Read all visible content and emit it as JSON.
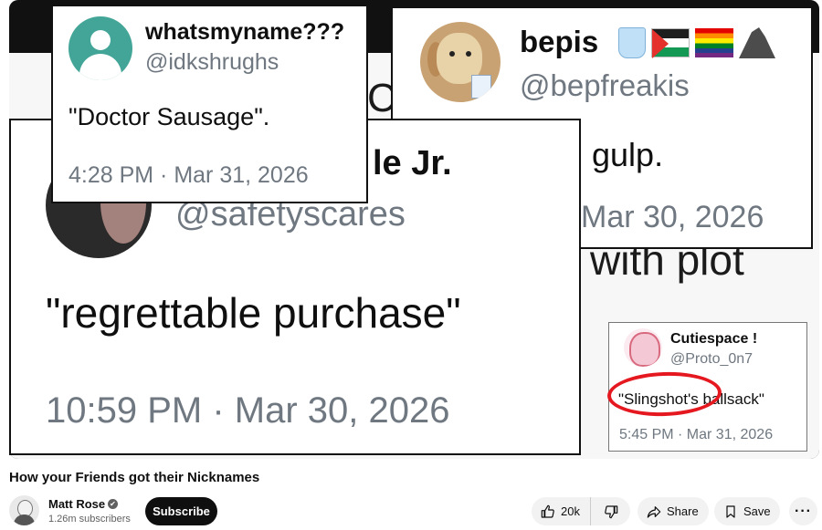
{
  "video": {
    "background_text_plot": "with plot",
    "background_text_fragment": "C",
    "cards": {
      "whatsmyname": {
        "name": "whatsmyname???",
        "handle": "@idkshrughs",
        "text": "\"Doctor Sausage\".",
        "timestamp": "4:28 PM · Mar 31, 2026"
      },
      "bepis": {
        "name": "bepis",
        "emojis": [
          "cup-with-straw-icon",
          "palestine-flag-icon",
          "rainbow-flag-icon",
          "rock-icon"
        ],
        "handle": "@bepfreakis",
        "text": "gulp.",
        "timestamp": "Mar 30, 2026"
      },
      "safetyscares": {
        "name": "le Jr.",
        "handle": "@safetyscares",
        "text": "\"regrettable purchase\"",
        "timestamp": "10:59 PM · Mar 30, 2026"
      },
      "cutiespace": {
        "name": "Cutiespace !",
        "handle": "@Proto_0n7",
        "text": "\"Slingshot's ballsack\"",
        "timestamp": "5:45 PM · Mar 31, 2026"
      }
    }
  },
  "title": "How your Friends got their Nicknames",
  "channel": {
    "name": "Matt Rose",
    "verified_mark": "✔",
    "subscribers": "1.26m subscribers",
    "subscribe_label": "Subscribe"
  },
  "actions": {
    "like_count": "20k",
    "share_label": "Share",
    "save_label": "Save",
    "more_label": "···"
  },
  "colors": {
    "highlight": "#e5171f",
    "avatar_teal": "#43a597",
    "handle_grey": "#6f7780"
  }
}
